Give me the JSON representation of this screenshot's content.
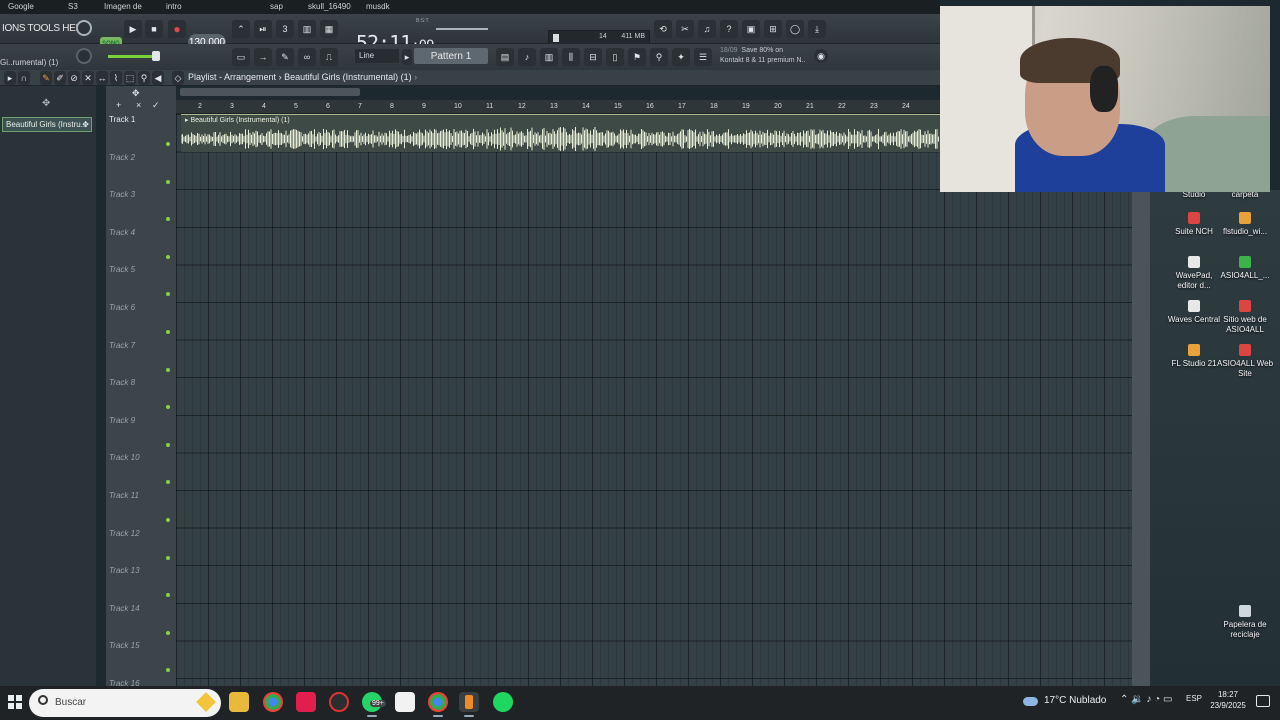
{
  "top_strip": {
    "items": [
      "Google",
      "S3",
      "Imagen de",
      "intro",
      "sap",
      "skull_16490",
      "musdk"
    ]
  },
  "fl": {
    "menu": "IONS TOOLS HELP",
    "song_mode": "SONG",
    "tempo": "130.000",
    "time_main": "52:11",
    "time_sub": ":09",
    "time_tag": "B:S:T",
    "memory_cpu": "14",
    "memory_ram": "411 MB",
    "memory_poly": "0",
    "snap": "Line",
    "pattern": "Pattern 1",
    "hint_date": "18/09",
    "hint_text": "Save 80% on",
    "hint_text2": "Kontakt 8 & 11 premium N..",
    "channel": "Gi..rumental) (1)",
    "breadcrumb": "Playlist - Arrangement",
    "breadcrumb_sep": "›",
    "breadcrumb_item": "Beautiful Girls (Instrumental) (1)",
    "picker_item": "Beautiful Girls (Instru...",
    "clip_title": "Beautiful Girls (Instrumental) (1)",
    "ruler": [
      "2",
      "3",
      "4",
      "5",
      "6",
      "7",
      "8",
      "9",
      "10",
      "11",
      "12",
      "13",
      "14",
      "15",
      "16",
      "17",
      "18",
      "19",
      "20",
      "21",
      "22",
      "23",
      "24"
    ],
    "tracks": [
      "Track 1",
      "Track 2",
      "Track 3",
      "Track 4",
      "Track 5",
      "Track 6",
      "Track 7",
      "Track 8",
      "Track 9",
      "Track 10",
      "Track 11",
      "Track 12",
      "Track 13",
      "Track 14",
      "Track 15",
      "Track 16"
    ]
  },
  "desktop_icons": [
    {
      "label": "Studio",
      "color": "#e8e8e8"
    },
    {
      "label": "carpeta",
      "color": "#e9a23b"
    },
    {
      "label": "Suite NCH",
      "color": "#d44"
    },
    {
      "label": "flstudio_wi...",
      "color": "#e9a23b"
    },
    {
      "label": "WavePad, editor d...",
      "color": "#e8e8e8"
    },
    {
      "label": "ASIO4ALL_...",
      "color": "#3bb34a"
    },
    {
      "label": "Waves Central",
      "color": "#e8e8e8"
    },
    {
      "label": "Sitio web de ASIO4ALL",
      "color": "#d44"
    },
    {
      "label": "FL Studio 21",
      "color": "#e9a23b"
    },
    {
      "label": "ASIO4ALL Web Site",
      "color": "#d44"
    },
    {
      "label": "Papelera de reciclaje",
      "color": "#cfd8dc"
    }
  ],
  "taskbar": {
    "search_placeholder": "Buscar",
    "weather": "17°C  Nublado",
    "lang": "ESP",
    "time": "18:27",
    "date": "23/9/2025",
    "whatsapp_badge": "99+"
  }
}
